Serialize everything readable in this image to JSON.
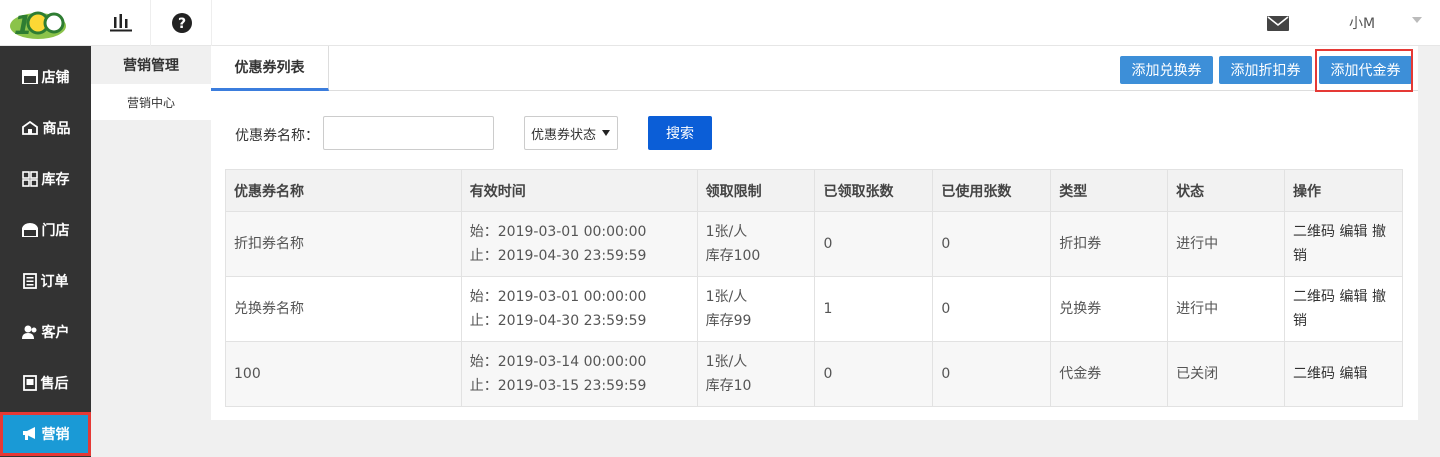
{
  "header": {
    "user_name": "小M",
    "icons": [
      "logo",
      "bar-chart-icon",
      "help-icon",
      "mail-icon",
      "chevron-down-icon"
    ]
  },
  "nav": {
    "items": [
      {
        "label": "店铺",
        "icon": "store-icon"
      },
      {
        "label": "商品",
        "icon": "product-icon"
      },
      {
        "label": "库存",
        "icon": "inventory-icon"
      },
      {
        "label": "门店",
        "icon": "shop-icon"
      },
      {
        "label": "订单",
        "icon": "order-icon"
      },
      {
        "label": "客户",
        "icon": "customer-icon"
      },
      {
        "label": "售后",
        "icon": "after-sales-icon"
      },
      {
        "label": "营销",
        "icon": "megaphone-icon",
        "active": true
      }
    ],
    "active_color": "#1a9ad6"
  },
  "subnav": {
    "title": "营销管理",
    "items": [
      "营销中心"
    ]
  },
  "main": {
    "tab": "优惠券列表",
    "buttons": [
      "添加兑换券",
      "添加折扣券",
      "添加代金券"
    ],
    "search": {
      "label": "优惠券名称：",
      "input_value": "",
      "input_placeholder": "",
      "status_select": "优惠券状态",
      "search_button": "搜索"
    },
    "table": {
      "headers": [
        "优惠券名称",
        "有效时间",
        "领取限制",
        "已领取张数",
        "已使用张数",
        "类型",
        "状态",
        "操作"
      ],
      "rows": [
        {
          "name": "折扣券名称",
          "start": "始：2019-03-01 00:00:00",
          "end": "止：2019-04-30 23:59:59",
          "limit": "1张/人",
          "stock": "库存100",
          "claimed": "0",
          "used": "0",
          "type": "折扣券",
          "status": "进行中",
          "ops": [
            "二维码",
            "编辑",
            "撤销"
          ]
        },
        {
          "name": "兑换券名称",
          "start": "始：2019-03-01 00:00:00",
          "end": "止：2019-04-30 23:59:59",
          "limit": "1张/人",
          "stock": "库存99",
          "claimed": "1",
          "used": "0",
          "type": "兑换券",
          "status": "进行中",
          "ops": [
            "二维码",
            "编辑",
            "撤销"
          ]
        },
        {
          "name": "100",
          "start": "始：2019-03-14 00:00:00",
          "end": "止：2019-03-15 23:59:59",
          "limit": "1张/人",
          "stock": "库存10",
          "claimed": "0",
          "used": "0",
          "type": "代金券",
          "status": "已关闭",
          "ops": [
            "二维码",
            "编辑"
          ]
        }
      ]
    }
  },
  "colors": {
    "primary_button": "#3d8fd8",
    "search_button": "#0b5ed7",
    "highlight_border": "#e53935",
    "nav_bg": "#333333"
  }
}
